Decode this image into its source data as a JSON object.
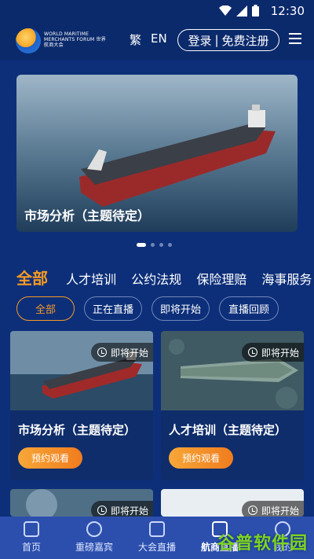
{
  "status": {
    "time": "12:30",
    "icons": [
      "wifi-icon",
      "signal-icon",
      "battery-icon"
    ]
  },
  "header": {
    "logo_text": "WORLD MARITIME MERCHANTS FORUM 世界航商大会",
    "lang_trad": "繁",
    "lang_en": "EN",
    "login": "登录",
    "register": "免费注册",
    "separator": "|"
  },
  "banner": {
    "title": "市场分析（主题待定）",
    "dots": 4,
    "active_dot": 1
  },
  "categories": [
    "全部",
    "人才培训",
    "公约法规",
    "保险理赔",
    "海事服务"
  ],
  "filters": [
    "全部",
    "正在直播",
    "即将开始",
    "直播回顾"
  ],
  "cards": [
    {
      "status": "即将开始",
      "title": "市场分析（主题待定）",
      "button": "预约观看"
    },
    {
      "status": "即将开始",
      "title": "人才培训（主题待定）",
      "button": "预约观看"
    },
    {
      "status": "即将开始"
    },
    {
      "status": "即将开始"
    }
  ],
  "nav": [
    "首页",
    "重磅嘉宾",
    "大会直播",
    "航商直播",
    "我的"
  ],
  "watermark": "谷普软件园",
  "colors": {
    "background": "#0d2f7a",
    "accent": "#f59a23",
    "nav": "#2c4fae"
  }
}
